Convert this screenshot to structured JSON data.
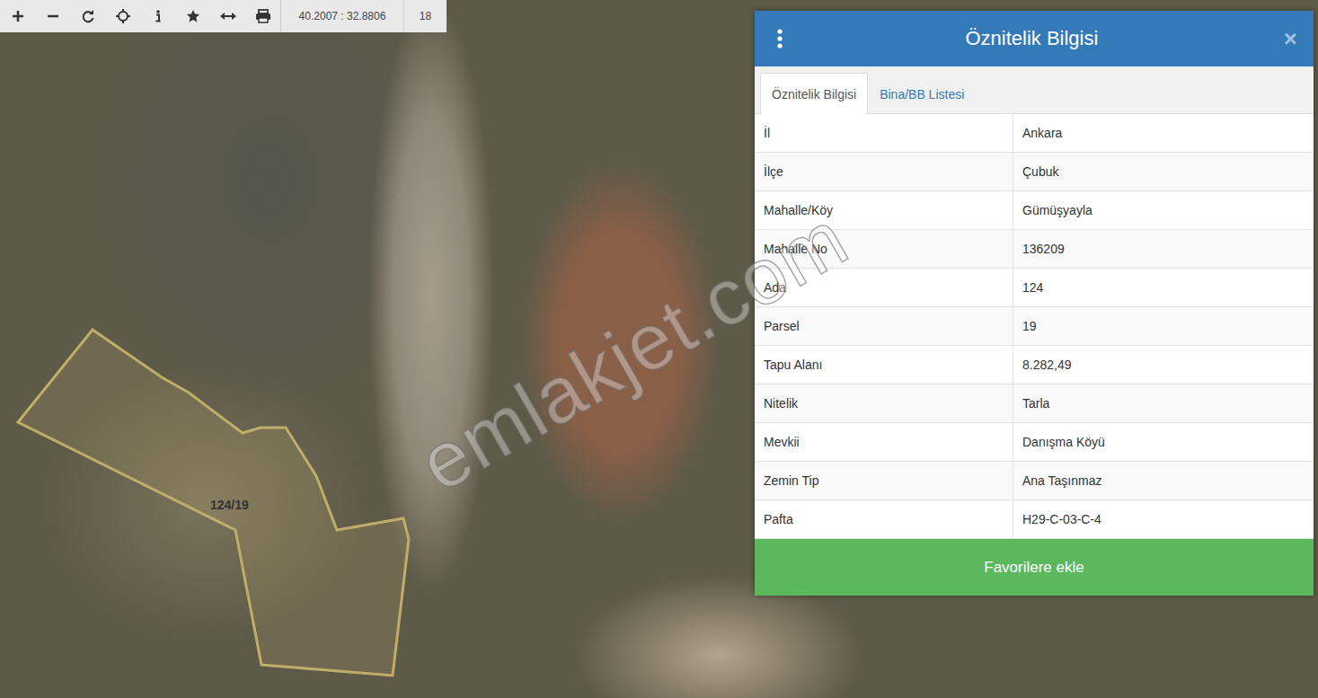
{
  "toolbar": {
    "coordinates": "40.2007 : 32.8806",
    "zoom": "18"
  },
  "map": {
    "parcel_label": "124/19",
    "watermark": "emlakjet.com"
  },
  "panel": {
    "title": "Öznitelik Bilgisi",
    "close": "×",
    "tabs": [
      {
        "label": "Öznitelik Bilgisi",
        "selected": true
      },
      {
        "label": "Bina/BB Listesi",
        "selected": false
      }
    ],
    "rows": [
      {
        "label": "İl",
        "value": "Ankara"
      },
      {
        "label": "İlçe",
        "value": "Çubuk"
      },
      {
        "label": "Mahalle/Köy",
        "value": "Gümüşyayla"
      },
      {
        "label": "Mahalle No",
        "value": "136209"
      },
      {
        "label": "Ada",
        "value": "124"
      },
      {
        "label": "Parsel",
        "value": "19"
      },
      {
        "label": "Tapu Alanı",
        "value": "8.282,49"
      },
      {
        "label": "Nitelik",
        "value": "Tarla"
      },
      {
        "label": "Mevkii",
        "value": "Danışma Köyü"
      },
      {
        "label": "Zemin Tip",
        "value": "Ana Taşınmaz"
      },
      {
        "label": "Pafta",
        "value": "H29-C-03-C-4"
      }
    ],
    "button": "Favorilere ekle"
  }
}
